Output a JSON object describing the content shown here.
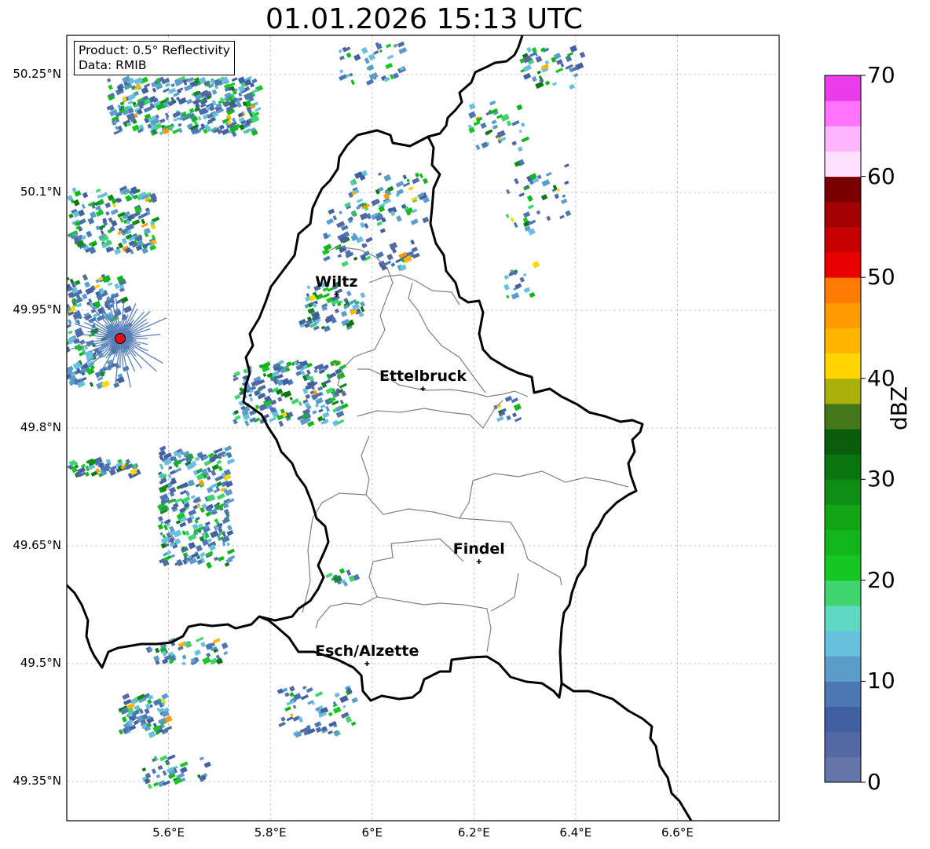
{
  "title": "01.01.2026 15:13 UTC",
  "info": {
    "product": "Product: 0.5° Reflectivity",
    "data_source": "Data: RMIB"
  },
  "colorbar": {
    "label": "dBZ",
    "ticks": [
      "0",
      "10",
      "20",
      "30",
      "40",
      "50",
      "60",
      "70"
    ],
    "colors": [
      "#6577aa",
      "#5468a4",
      "#425fa2",
      "#4b78b2",
      "#5b9cc8",
      "#67c0dc",
      "#5fd8c2",
      "#3fd46e",
      "#16c622",
      "#13b61a",
      "#11a516",
      "#0e8d15",
      "#0a7610",
      "#0a5d0c",
      "#44761a",
      "#a9b00a",
      "#ffd400",
      "#ffb400",
      "#ff9a00",
      "#ff7a00",
      "#e80000",
      "#c60000",
      "#a30000",
      "#7a0000",
      "#ffe0ff",
      "#ffb6ff",
      "#ff73ff",
      "#ea3cea"
    ]
  },
  "axes": {
    "lat_ticks": [
      "50.25°N",
      "50.1°N",
      "49.95°N",
      "49.8°N",
      "49.65°N",
      "49.5°N",
      "49.35°N"
    ],
    "lon_ticks": [
      "5.6°E",
      "5.8°E",
      "6°E",
      "6.2°E",
      "6.4°E",
      "6.6°E"
    ]
  },
  "cities": [
    {
      "name": "Wiltz",
      "lon": 5.93,
      "lat": 49.97
    },
    {
      "name": "Ettelbruck",
      "lon": 6.1,
      "lat": 49.85
    },
    {
      "name": "Findel",
      "lon": 6.21,
      "lat": 49.63
    },
    {
      "name": "Esch/Alzette",
      "lon": 5.99,
      "lat": 49.5
    }
  ],
  "radar_site": {
    "lon": 5.505,
    "lat": 49.914
  },
  "map_extent": {
    "lon": [
      5.4,
      6.8
    ],
    "lat": [
      49.3,
      50.3
    ]
  }
}
